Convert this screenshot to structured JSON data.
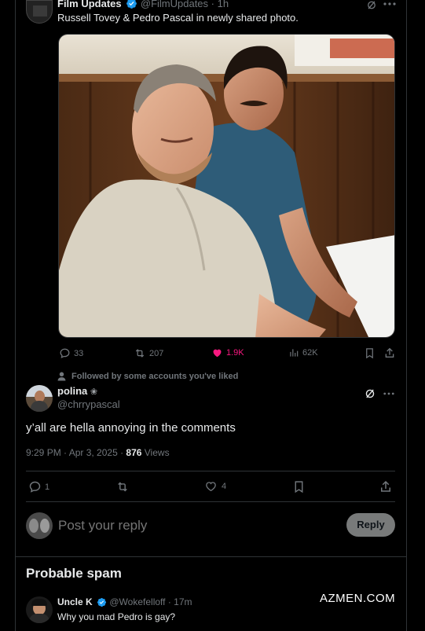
{
  "quoted_post": {
    "author_name": "Film Updates",
    "handle": "@FilmUpdates",
    "time": "· 1h",
    "text": "Russell Tovey & Pedro Pascal in newly shared photo.",
    "metrics": {
      "replies": "33",
      "reposts": "207",
      "likes": "1.9K",
      "views": "62K"
    },
    "like_color": "#f91880"
  },
  "social_context": "Followed by some accounts you've liked",
  "reply_post": {
    "author_name": "polina",
    "handle": "@chrrypascal",
    "text": "y’all are hella annoying in the comments",
    "timestamp": "9:29 PM · Apr 3, 2025 · ",
    "views_count": "876",
    "views_label": " Views",
    "metrics": {
      "replies": "1",
      "reposts": "",
      "likes": "4"
    }
  },
  "composer": {
    "placeholder": "Post your reply",
    "button": "Reply"
  },
  "spam_section": {
    "heading": "Probable spam",
    "author_name": "Uncle K",
    "handle": "@Wokefelloff",
    "time": "· 17m",
    "text": "Why you mad Pedro is gay?"
  },
  "watermark": "AZMEN.COM",
  "colors": {
    "accent": "#1d9bf0",
    "background": "#000000",
    "border": "#2f3336"
  }
}
